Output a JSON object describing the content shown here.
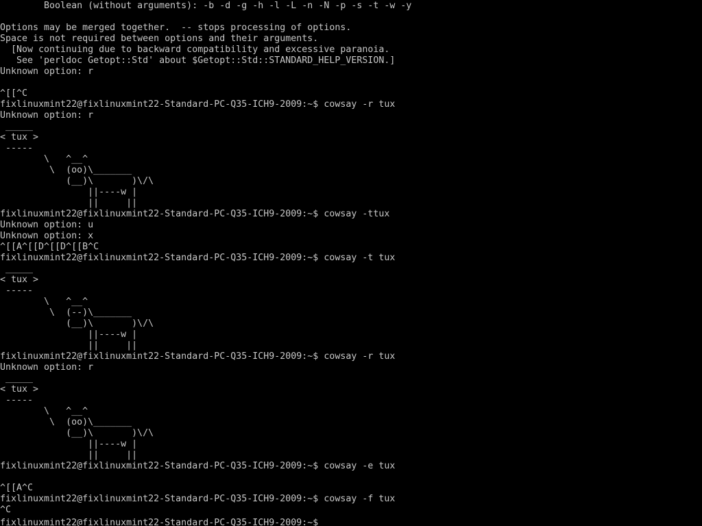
{
  "terminal": {
    "foreground": "#c8c8c8",
    "background": "#000000",
    "prompt": "fixlinuxmint22@fixlinuxmint22-Standard-PC-Q35-ICH9-2009:~$",
    "lines": [
      "        Boolean (without arguments): -b -d -g -h -l -L -n -N -p -s -t -w -y",
      "",
      "Options may be merged together.  -- stops processing of options.",
      "Space is not required between options and their arguments.",
      "  [Now continuing due to backward compatibility and excessive paranoia.",
      "   See 'perldoc Getopt::Std' about $Getopt::Std::STANDARD_HELP_VERSION.]",
      "Unknown option: r",
      "",
      "^[[^C",
      "fixlinuxmint22@fixlinuxmint22-Standard-PC-Q35-ICH9-2009:~$ cowsay -r tux",
      "Unknown option: r",
      " _____",
      "< tux >",
      " -----",
      "        \\   ^__^",
      "         \\  (oo)\\_______",
      "            (__)\\       )\\/\\",
      "                ||----w |",
      "                ||     ||",
      "fixlinuxmint22@fixlinuxmint22-Standard-PC-Q35-ICH9-2009:~$ cowsay -ttux",
      "Unknown option: u",
      "Unknown option: x",
      "^[[A^[[D^[[D^[[B^C",
      "fixlinuxmint22@fixlinuxmint22-Standard-PC-Q35-ICH9-2009:~$ cowsay -t tux",
      " _____",
      "< tux >",
      " -----",
      "        \\   ^__^",
      "         \\  (--)\\_______",
      "            (__)\\       )\\/\\",
      "                ||----w |",
      "                ||     ||",
      "fixlinuxmint22@fixlinuxmint22-Standard-PC-Q35-ICH9-2009:~$ cowsay -r tux",
      "Unknown option: r",
      " _____",
      "< tux >",
      " -----",
      "        \\   ^__^",
      "         \\  (oo)\\_______",
      "            (__)\\       )\\/\\",
      "                ||----w |",
      "                ||     ||",
      "fixlinuxmint22@fixlinuxmint22-Standard-PC-Q35-ICH9-2009:~$ cowsay -e tux",
      "",
      "^[[A^C",
      "fixlinuxmint22@fixlinuxmint22-Standard-PC-Q35-ICH9-2009:~$ cowsay -f tux",
      "^C",
      "fixlinuxmint22@fixlinuxmint22-Standard-PC-Q35-ICH9-2009:~$ "
    ]
  }
}
